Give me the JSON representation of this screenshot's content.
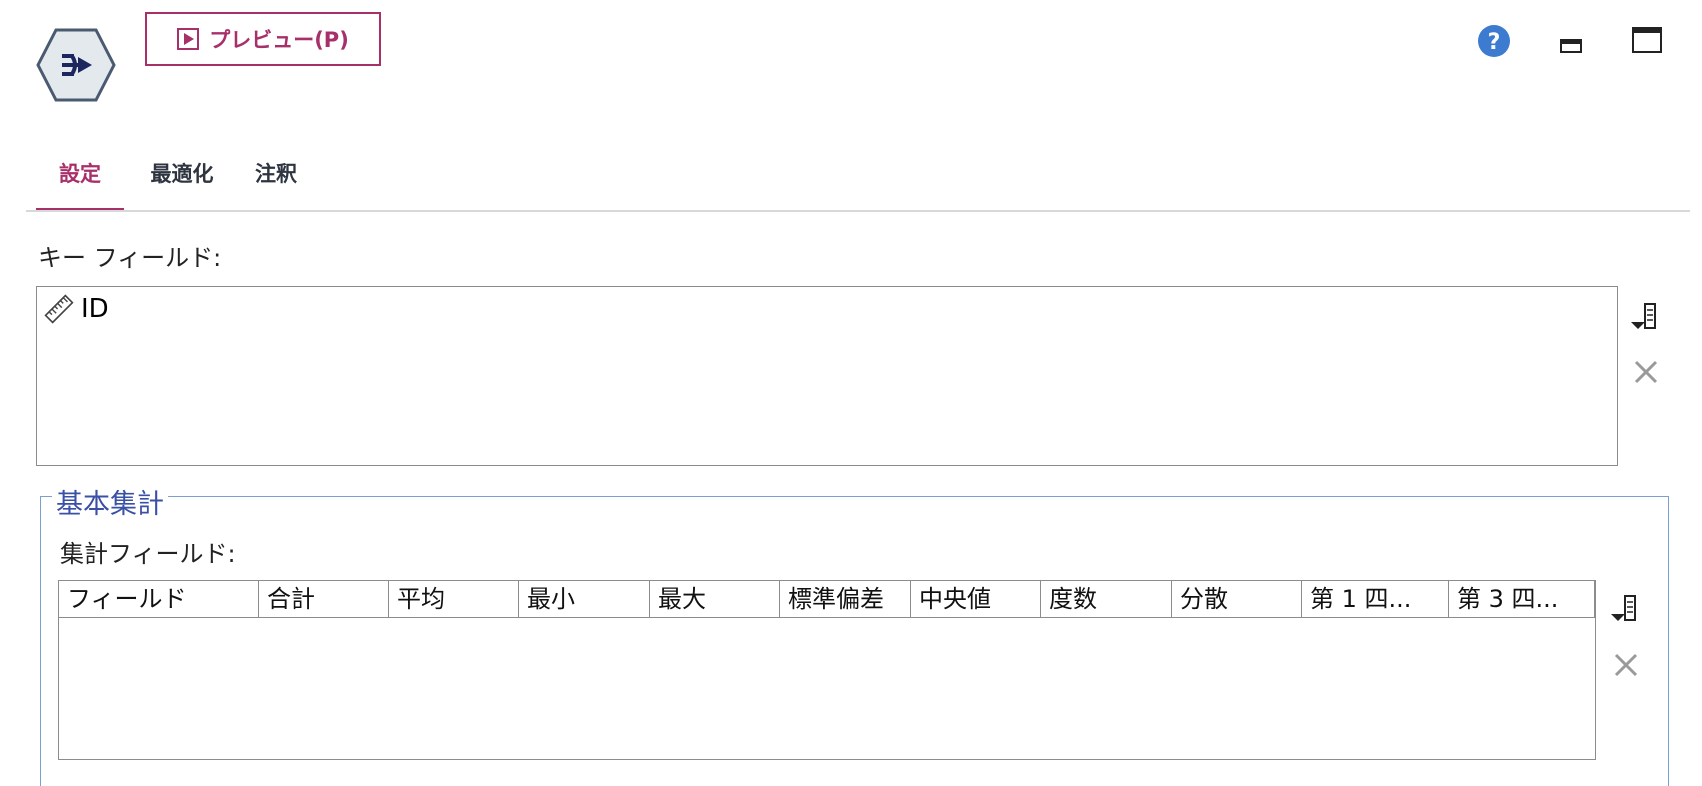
{
  "header": {
    "node_icon": "merge-node-icon",
    "preview_label": "プレビュー(P)",
    "preview_icon": "play-icon",
    "help_icon": "help-icon",
    "minimize_icon": "minimize-icon",
    "maximize_icon": "maximize-icon"
  },
  "tabs": [
    {
      "label": "設定",
      "active": true
    },
    {
      "label": "最適化",
      "active": false
    },
    {
      "label": "注釈",
      "active": false
    }
  ],
  "key_fields": {
    "label": "キー フィールド:",
    "items": [
      {
        "name": "ID",
        "icon": "ruler-icon"
      }
    ]
  },
  "basic_aggregates": {
    "title": "基本集計",
    "fields_label": "集計フィールド:",
    "columns": [
      "フィールド",
      "合計",
      "平均",
      "最小",
      "最大",
      "標準偏差",
      "中央値",
      "度数",
      "分散",
      "第 1 四...",
      "第 3 四..."
    ]
  },
  "colors": {
    "accent": "#a8306a",
    "group_title": "#3a4fa6",
    "help": "#3d7bd0"
  }
}
